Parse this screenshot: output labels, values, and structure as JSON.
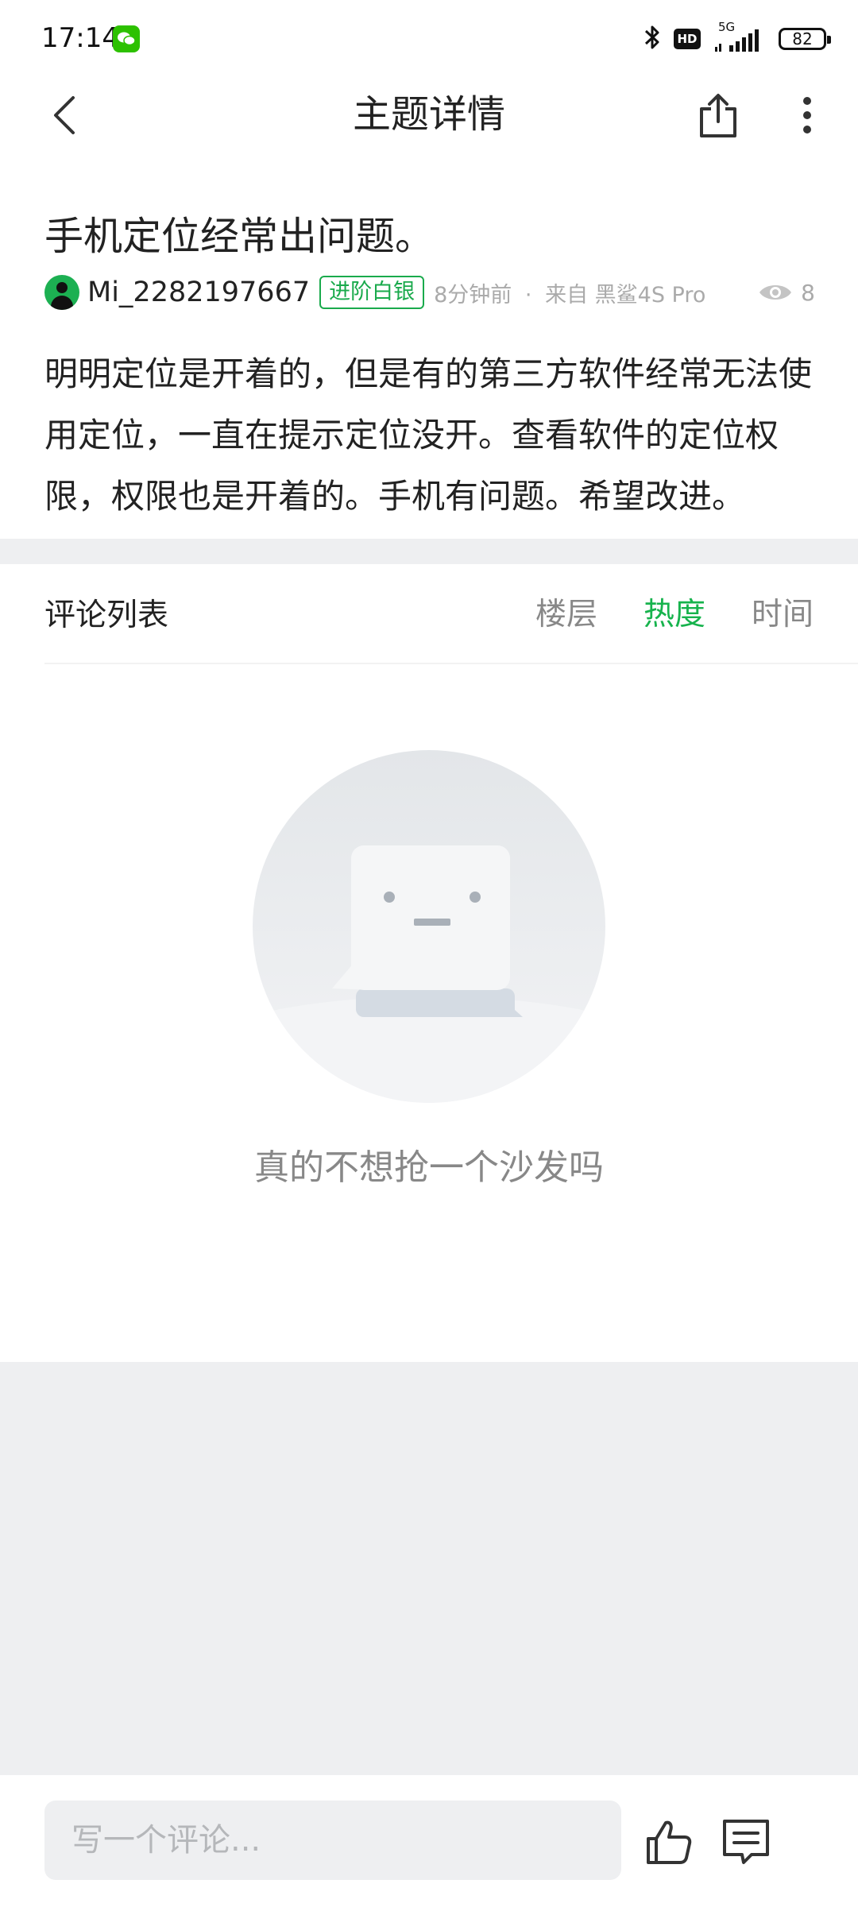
{
  "status_bar": {
    "time": "17:14",
    "network": "5G",
    "hd": "HD",
    "battery": "82"
  },
  "header": {
    "title": "主题详情",
    "icons": [
      "back-icon",
      "share-icon",
      "more-vertical-icon"
    ]
  },
  "post": {
    "title": "手机定位经常出问题。",
    "author": "Mi_2282197667",
    "level": "进阶白银",
    "time_ago": "8分钟前",
    "source": "来自 黑鲨4S Pro",
    "views": "8",
    "body": "明明定位是开着的，但是有的第三方软件经常无法使用定位，一直在提示定位没开。查看软件的定位权限，权限也是开着的。手机有问题。希望改进。"
  },
  "comments": {
    "title": "评论列表",
    "sort_options": [
      "楼层",
      "热度",
      "时间"
    ],
    "active_sort": "热度",
    "empty_text": "真的不想抢一个沙发吗"
  },
  "bottom_bar": {
    "placeholder": "写一个评论..."
  },
  "colors": {
    "accent": "#17b34d",
    "band": "#eeeff1"
  }
}
